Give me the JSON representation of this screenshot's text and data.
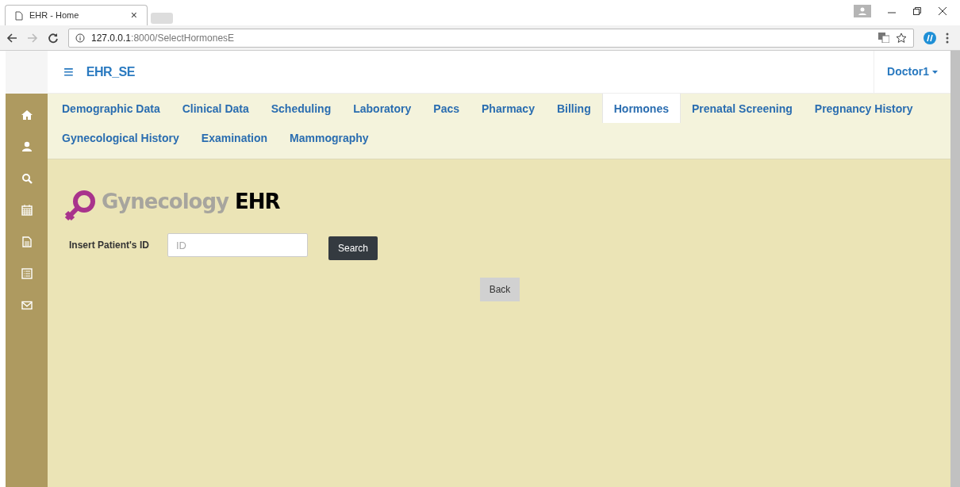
{
  "browser": {
    "tab_title": "EHR - Home",
    "tab_close": "×",
    "url_host": "127.0.0.1",
    "url_rest": ":8000/SelectHormonesE"
  },
  "navbar": {
    "menu_icon": "≡",
    "brand": "EHR_SE",
    "user_menu": "Doctor1"
  },
  "tabs": [
    {
      "label": "Demographic Data",
      "selected": false
    },
    {
      "label": "Clinical Data",
      "selected": false
    },
    {
      "label": "Scheduling",
      "selected": false
    },
    {
      "label": "Laboratory",
      "selected": false
    },
    {
      "label": "Pacs",
      "selected": false
    },
    {
      "label": "Pharmacy",
      "selected": false
    },
    {
      "label": "Billing",
      "selected": false
    },
    {
      "label": "Hormones",
      "selected": true
    },
    {
      "label": "Prenatal Screening",
      "selected": false
    },
    {
      "label": "Pregnancy History",
      "selected": false
    },
    {
      "label": "Gynecological History",
      "selected": false
    },
    {
      "label": "Examination",
      "selected": false
    },
    {
      "label": "Mammography",
      "selected": false
    }
  ],
  "logo": {
    "word_1": "Gynecology",
    "word_2": "EHR"
  },
  "form": {
    "label": "Insert Patient's ID",
    "placeholder": "ID",
    "search_button": "Search",
    "back_button": "Back"
  }
}
